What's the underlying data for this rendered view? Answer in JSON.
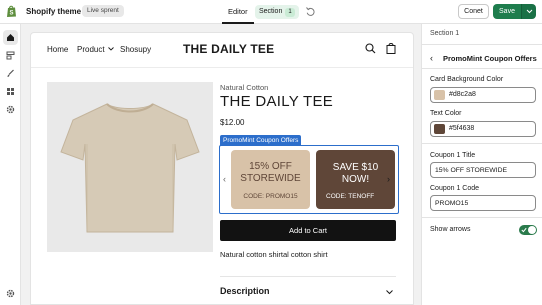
{
  "topbar": {
    "title": "Shopify theme",
    "badge": "Live sprent",
    "editor_tab": "Editor",
    "section_tab": "Section",
    "section_count": "1",
    "conet_label": "Conet",
    "save_label": "Save"
  },
  "store": {
    "nav": [
      "Home",
      "Product",
      "Shosupy"
    ],
    "title": "THE DAILY TEE"
  },
  "product": {
    "brand": "Natural Cotton",
    "title": "THE DAILY TEE",
    "price": "$12.00",
    "add_to_cart": "Add to Cart",
    "description": "Natural cotton shirtal cotton shirt",
    "description_heading": "Description"
  },
  "carousel": {
    "tag": "PromoMint Coupon Offers",
    "cards": [
      {
        "title": "15% OFF STOREWIDE",
        "code": "CODE: PROMO15"
      },
      {
        "title": "SAVE $10 NOW!",
        "code": "CODE: TENOFF"
      }
    ]
  },
  "panel": {
    "section_label": "Section 1",
    "heading": "PromoMint Coupon Offers",
    "card_bg_label": "Card Background Color",
    "card_bg_value": "#d8c2a8",
    "text_color_label": "Text Color",
    "text_color_value": "#5f4638",
    "coupon1_title_label": "Coupon 1 Title",
    "coupon1_title_value": "15% OFF STOREWIDE",
    "coupon1_code_label": "Coupon 1 Code",
    "coupon1_code_value": "PROMO15",
    "show_arrows_label": "Show arrows",
    "show_arrows_on": true
  },
  "colors": {
    "accent_green": "#1e7d4d",
    "selection_blue": "#2c6ecb",
    "card_bg": "#d8c2a8",
    "card_text": "#5f4638"
  },
  "icons": [
    "shopify-logo-icon",
    "undo-icon",
    "chevron-down-icon",
    "home-icon",
    "sections-icon",
    "brush-icon",
    "apps-icon",
    "settings-icon",
    "search-icon",
    "bag-icon",
    "back-icon",
    "check-icon"
  ]
}
